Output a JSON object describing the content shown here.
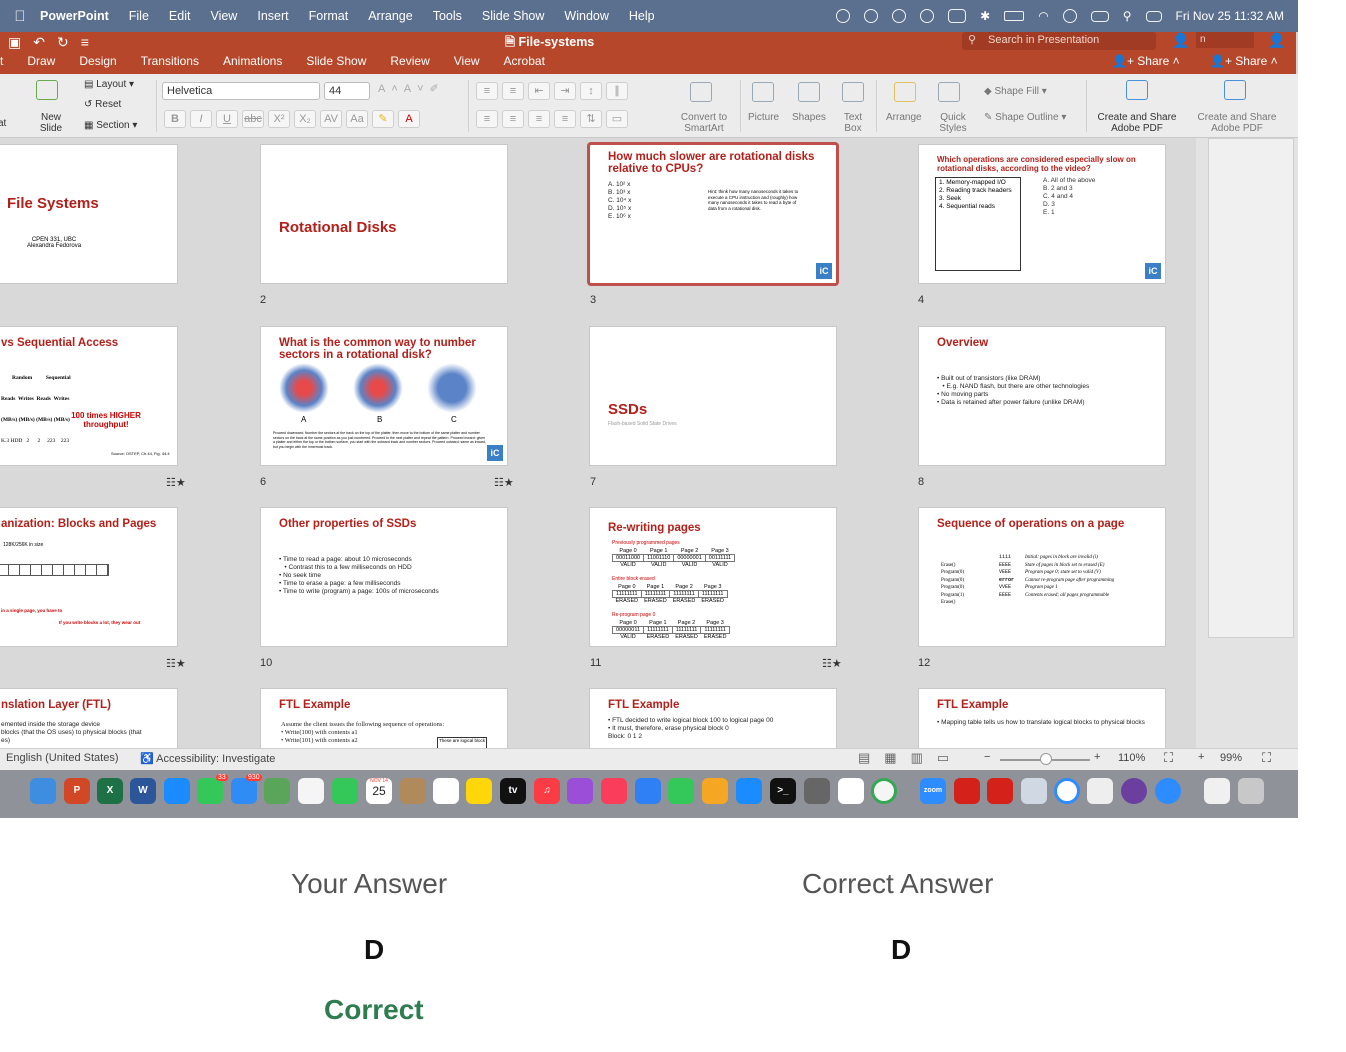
{
  "menubar": {
    "apple": "",
    "items": [
      "PowerPoint",
      "File",
      "Edit",
      "View",
      "Insert",
      "Format",
      "Arrange",
      "Tools",
      "Slide Show",
      "Window",
      "Help"
    ],
    "datetime": "Fri Nov 25  11:32 AM"
  },
  "titlebar": {
    "doc_title": "File-systems",
    "search_placeholder": "Search in Presentation",
    "share": "Share",
    "share2": "Share",
    "field2": "n",
    "tabs": [
      "rt",
      "Draw",
      "Design",
      "Transitions",
      "Animations",
      "Slide Show",
      "Review",
      "View",
      "Acrobat"
    ]
  },
  "ribbon": {
    "new_slide": "New\nSlide",
    "layout": "Layout",
    "reset": "Reset",
    "section": "Section",
    "at": "at",
    "font": "Helvetica",
    "size": "44",
    "convert": "Convert to\nSmartArt",
    "picture": "Picture",
    "shapes": "Shapes",
    "textbox": "Text\nBox",
    "arrange": "Arrange",
    "quick_styles": "Quick\nStyles",
    "shape_fill": "Shape Fill",
    "shape_outline": "Shape Outline",
    "create_share": "Create and Share\nAdobe PDF",
    "create_share2": "Create and Share\nAdobe PDF"
  },
  "slides": {
    "s1": {
      "title": "File Systems",
      "sub1": "CPEN 331, UBC",
      "sub2": "Alexandra Fedorova"
    },
    "s2": {
      "title": "Rotational Disks",
      "num": "2"
    },
    "s3": {
      "title": "How much slower are rotational disks relative to CPUs?",
      "num": "3",
      "options": [
        "A.  10² x",
        "B.  10³ x",
        "C.  10⁴ x",
        "D.  10⁵ x",
        "E.  10⁶ x"
      ],
      "hint": "Hint: think how many nanoseconds it takes to execute a CPU instruction and (roughly) how many nanoseconds it takes to read a byte of data from a rotational disk."
    },
    "s4": {
      "title": "Which operations are considered especially slow on rotational disks, according to the video?",
      "num": "4",
      "list": [
        "1.  Memory-mapped I/O",
        "2.  Reading track headers",
        "3.  Seek",
        "4.  Sequential reads"
      ],
      "options": [
        "A.  All of the above",
        "B.  2 and 3",
        "C.  4 and 4",
        "D.  3",
        "E.  1"
      ]
    },
    "s5": {
      "title": "vs Sequential Access",
      "random": "Random",
      "sequential": "Sequential",
      "rw": "Reads  Writes  Reads  Writes",
      "units": "(MB/s) (MB/s) (MB/s) (MB/s)",
      "row": "K.3 HDD   2      2     223    223",
      "callout": "100 times HIGHER throughput!",
      "source": "Source: OSTEP, Ch.44, Fig. 44.4"
    },
    "s6": {
      "title": "What is the common way to number sectors in a rotational disk?",
      "num": "6",
      "labels": [
        "A",
        "B",
        "C"
      ],
      "text": "Proceed downward: Number the sectors at the track on the top of the platter, then move to the bottom of the same platter and number sectors on the back at the same position as you just numbered. Proceed to the next platter and repeat the pattern. Proceed inward: given a platter and either the top or the bottom surface, you start with the outward track and number sectors. Proceed outward: same as inward, but you begin with the innermost track."
    },
    "s7": {
      "title": "SSDs",
      "sub": "Flash-based Solid State Drives",
      "num": "7"
    },
    "s8": {
      "title": "Overview",
      "num": "8",
      "bullets": [
        "• Built out of transistors (like DRAM)",
        "   • E.g. NAND flash, but there are other technologies",
        "• No moving parts",
        "• Data is retained after power failure (unlike DRAM)"
      ]
    },
    "s9": {
      "title": "anization: Blocks and Pages",
      "line1": "128K/256K in size",
      "foot1": "in a single page, you have to",
      "foot2": "If you write blocks a lot, they wear out"
    },
    "s10": {
      "title": "Other properties of SSDs",
      "num": "10",
      "bullets": [
        "• Time to read a page: about 10 microseconds",
        "   • Contrast this to a few milliseconds on HDD",
        "• No seek time",
        "• Time to erase a page: a few milliseconds",
        "• Time to write (program) a page: 100s of microseconds"
      ]
    },
    "s11": {
      "title": "Re-writing pages",
      "num": "11",
      "sec1": "Previously programmed pages",
      "sec2": "Entire block erased",
      "sec3": "Re-program page 0",
      "pages": [
        "Page 0",
        "Page 1",
        "Page 2",
        "Page 3"
      ],
      "v1": [
        "00011000",
        "11001110",
        "00000001",
        "00111111"
      ],
      "s1": [
        "VALID",
        "VALID",
        "VALID",
        "VALID"
      ],
      "v2": [
        "11111111",
        "11111111",
        "11111111",
        "11111111"
      ],
      "s2": [
        "ERASED",
        "ERASED",
        "ERASED",
        "ERASED"
      ],
      "v3": [
        "00000011",
        "11111111",
        "11111111",
        "11111111"
      ],
      "s3": [
        "VALID",
        "ERASED",
        "ERASED",
        "ERASED"
      ]
    },
    "s12": {
      "title": "Sequence of operations on a page",
      "num": "12",
      "ops": [
        "Erase()",
        "Program(0)",
        "Program(0)",
        "Program(0)",
        "Program(1)",
        "Erase()"
      ],
      "states": [
        "iiii",
        "EEEE",
        "VEEE",
        "error",
        "VVEE",
        "EEEE"
      ],
      "notes": [
        "Initial: pages in block are invalid (i)",
        "State of pages in block set to erased (E)",
        "Program page 0; state set to valid (V)",
        "Cannot re-program page after programming",
        "Program page 1",
        "Contents erased; all pages programmable"
      ]
    },
    "s13": {
      "title": "nslation Layer (FTL)",
      "l1": "emented inside the storage device",
      "l2": "blocks (that the OS uses) to physical blocks (that",
      "l3": "es)"
    },
    "s14": {
      "title": "FTL Example",
      "l1": "Assume the client issues the following sequence of operations:",
      "l2": "• Write(100) with contents a1",
      "l3": "• Write(101) with contents a2",
      "box": "These are logical block"
    },
    "s15": {
      "title": "FTL Example",
      "l1": "• FTL decided to write logical block 100 to logical page 00",
      "l2": "• It must, therefore, erase physical block 0",
      "l3": "Block:        0              1              2"
    },
    "s16": {
      "title": "FTL Example",
      "l1": "• Mapping table tells us how to translate logical blocks to physical blocks"
    }
  },
  "status": {
    "language": "English (United States)",
    "accessibility": "Accessibility: Investigate",
    "zoom": "110%",
    "zoom2": "99%"
  },
  "dock": {
    "calendar_month": "NOV 14",
    "calendar_day": "25",
    "badge_mail": "930",
    "badge_msg": "33"
  },
  "quiz": {
    "your_label": "Your Answer",
    "correct_label": "Correct Answer",
    "your_value": "D",
    "correct_value": "D",
    "result": "Correct"
  }
}
